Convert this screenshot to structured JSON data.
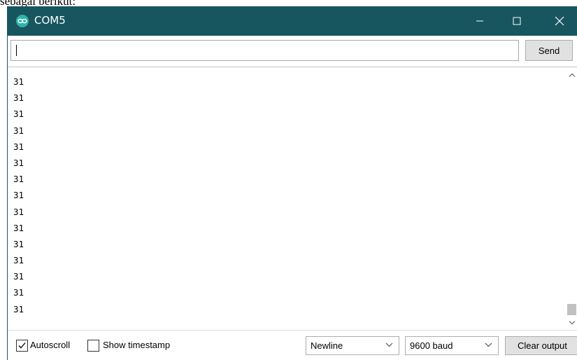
{
  "page_text_cutoff": "sebagai berikut:",
  "window": {
    "title": "COM5",
    "titlebar_color": "#17565f",
    "logo_color": "#2fb3a8",
    "controls": {
      "minimize_icon": "minimize-icon",
      "maximize_icon": "maximize-icon",
      "close_icon": "close-icon"
    }
  },
  "input": {
    "value": "",
    "send_label": "Send"
  },
  "output": {
    "lines": [
      "31",
      "31",
      "31",
      "31",
      "31",
      "31",
      "31",
      "31",
      "31",
      "31",
      "31",
      "31",
      "31",
      "31",
      "31"
    ]
  },
  "footer": {
    "autoscroll": {
      "label": "Autoscroll",
      "checked": true
    },
    "show_timestamp": {
      "label": "Show timestamp",
      "checked": false
    },
    "line_ending": {
      "selected": "Newline"
    },
    "baud_rate": {
      "selected": "9600 baud"
    },
    "clear_label": "Clear output"
  }
}
